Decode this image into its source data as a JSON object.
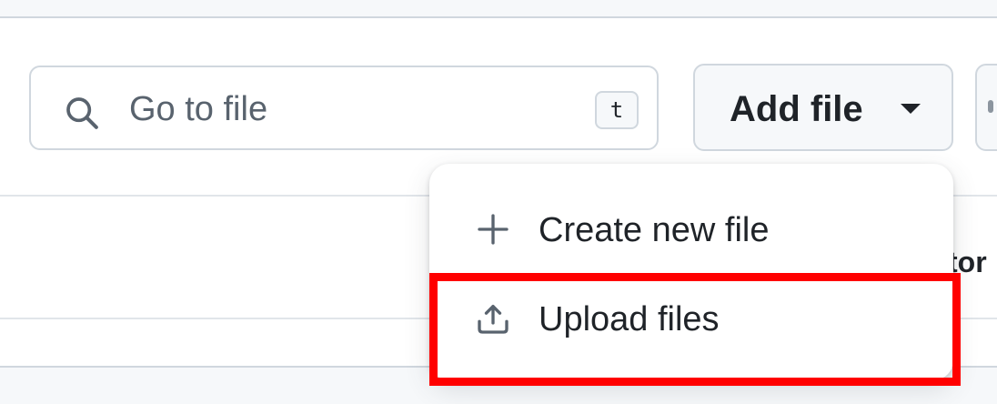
{
  "search": {
    "placeholder": "Go to file",
    "shortcut_key": "t",
    "icon": "search-icon"
  },
  "add_file_button": {
    "label": "Add file",
    "icon": "triangle-down-icon"
  },
  "partial_text": "tor",
  "dropdown": {
    "items": [
      {
        "label": "Create new file",
        "icon": "plus-icon"
      },
      {
        "label": "Upload files",
        "icon": "upload-icon"
      }
    ]
  },
  "colors": {
    "text": "#1f2328",
    "muted": "#59636e",
    "border": "#d0d7de",
    "button_bg": "#f6f8fa",
    "highlight": "#ff0000"
  }
}
